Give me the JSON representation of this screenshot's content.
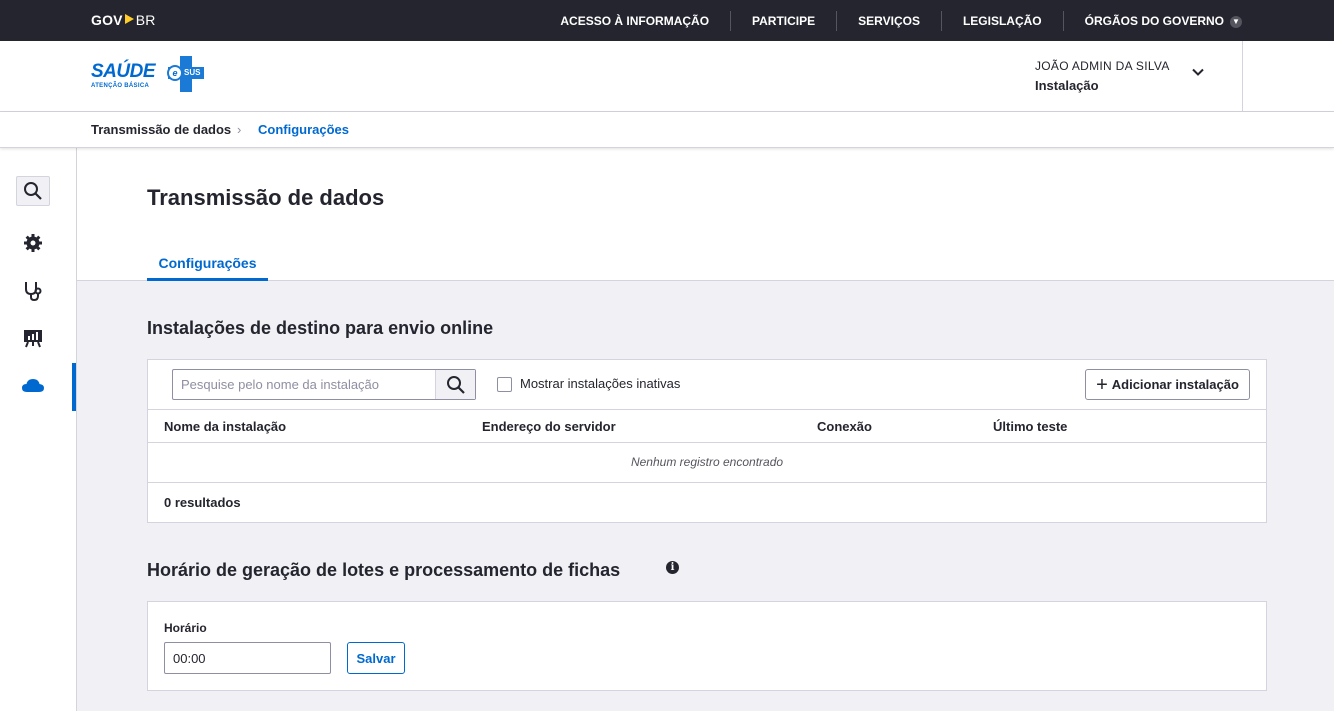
{
  "govbar": {
    "logo_gov": "GOV",
    "logo_br": "BR",
    "nav": [
      "ACESSO À INFORMAÇÃO",
      "PARTICIPE",
      "SERVIÇOS",
      "LEGISLAÇÃO",
      "ÓRGÃOS DO GOVERNO"
    ]
  },
  "header": {
    "logo_text": "SAÚDE",
    "logo_e": "e",
    "logo_sus": "SUS",
    "logo_sub": "ATENÇÃO BÁSICA",
    "user_name": "JOÃO ADMIN DA SILVA",
    "user_role": "Instalação"
  },
  "breadcrumb": {
    "items": [
      "Transmissão de dados",
      "Configurações"
    ],
    "separator": "›"
  },
  "sidebar": {
    "icons": [
      "search-icon",
      "gear-icon",
      "stethoscope-icon",
      "presentation-board-icon",
      "cloud-icon"
    ],
    "active": "cloud-icon"
  },
  "page": {
    "title": "Transmissão de dados",
    "tab": "Configurações"
  },
  "destinations": {
    "title": "Instalações de destino para envio online",
    "search_placeholder": "Pesquise pelo nome da instalação",
    "checkbox_label": "Mostrar instalações inativas",
    "add_button": "Adicionar instalação",
    "columns": [
      "Nome da instalação",
      "Endereço do servidor",
      "Conexão",
      "Último teste"
    ],
    "empty_text": "Nenhum registro encontrado",
    "results": "0 resultados"
  },
  "schedule": {
    "title": "Horário de geração de lotes e processamento de fichas",
    "field_label": "Horário",
    "field_value": "00:00",
    "save_button": "Salvar"
  },
  "colors": {
    "primary": "#0069d0",
    "dark": "#24252e",
    "accent_yellow": "#ffcc29"
  }
}
